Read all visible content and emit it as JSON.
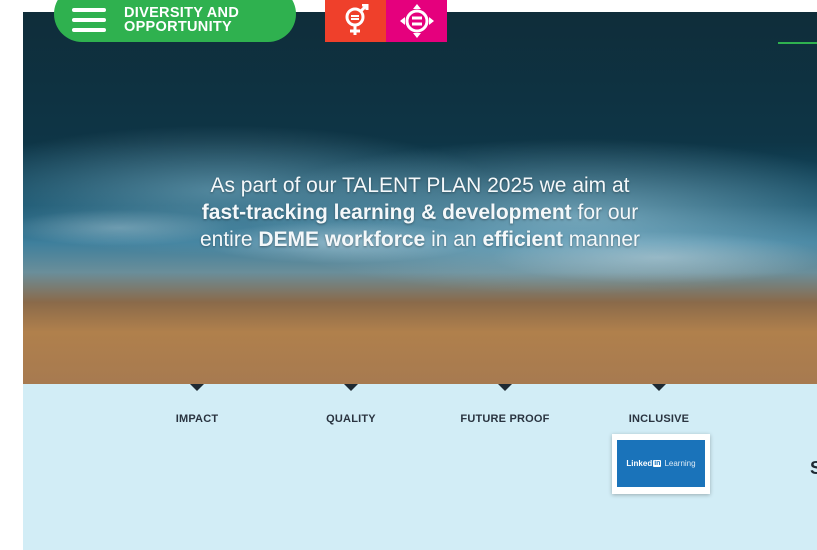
{
  "nav": {
    "menu_label_line1": "DIVERSITY AND",
    "menu_label_line2": "OPPORTUNITY",
    "menu_icon": "hamburger-menu-icon",
    "accent_color": "#2fb14f"
  },
  "sdg_badges": [
    {
      "icon": "gender-equality-icon",
      "color": "#ef402b"
    },
    {
      "icon": "reduced-inequalities-icon",
      "color": "#e5007d"
    }
  ],
  "hero": {
    "line1": "As part of our TALENT PLAN 2025 we aim at",
    "line2_bold": "fast-tracking learning & development",
    "line2_rest": " for our",
    "line3_a": "entire ",
    "line3_bold1": "DEME workforce",
    "line3_b": " in an ",
    "line3_bold2": "efficient",
    "line3_c": " manner"
  },
  "pillars": [
    "IMPACT",
    "QUALITY",
    "FUTURE PROOF",
    "INCLUSIVE"
  ],
  "linkedin_badge": {
    "word": "Linked",
    "in": "in",
    "learning": "Learning",
    "color": "#1a73ba"
  },
  "edge_text": "S",
  "band_color": "#d2edf6"
}
